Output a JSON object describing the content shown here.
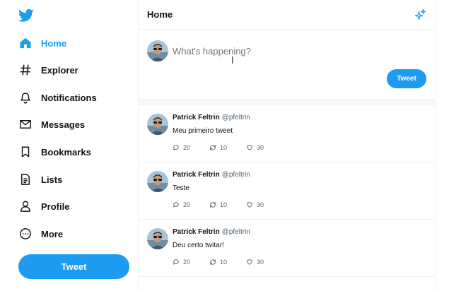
{
  "sidebar": {
    "logo_icon": "twitter-bird-icon",
    "accent": "#1d9bf0",
    "items": [
      {
        "label": "Home",
        "icon": "home-icon",
        "active": true
      },
      {
        "label": "Explorer",
        "icon": "hashtag-icon"
      },
      {
        "label": "Notifications",
        "icon": "bell-icon"
      },
      {
        "label": "Messages",
        "icon": "envelope-icon"
      },
      {
        "label": "Bookmarks",
        "icon": "bookmark-icon"
      },
      {
        "label": "Lists",
        "icon": "list-document-icon"
      },
      {
        "label": "Profile",
        "icon": "person-icon"
      },
      {
        "label": "More",
        "icon": "more-circle-icon"
      }
    ],
    "tweet_button": "Tweet"
  },
  "header": {
    "title": "Home",
    "sparkle_icon": "sparkle-icon"
  },
  "composer": {
    "placeholder": "What's happening?",
    "button": "Tweet"
  },
  "tweets": [
    {
      "name": "Patrick Feltrin",
      "handle": "@pfeltrin",
      "text": "Meu primeiro tweet",
      "replies": "20",
      "retweets": "10",
      "likes": "30"
    },
    {
      "name": "Patrick Feltrin",
      "handle": "@pfeltrin",
      "text": "Teste",
      "replies": "20",
      "retweets": "10",
      "likes": "30"
    },
    {
      "name": "Patrick Feltrin",
      "handle": "@pfeltrin",
      "text": "Deu certo twitar!",
      "replies": "20",
      "retweets": "10",
      "likes": "30"
    }
  ]
}
